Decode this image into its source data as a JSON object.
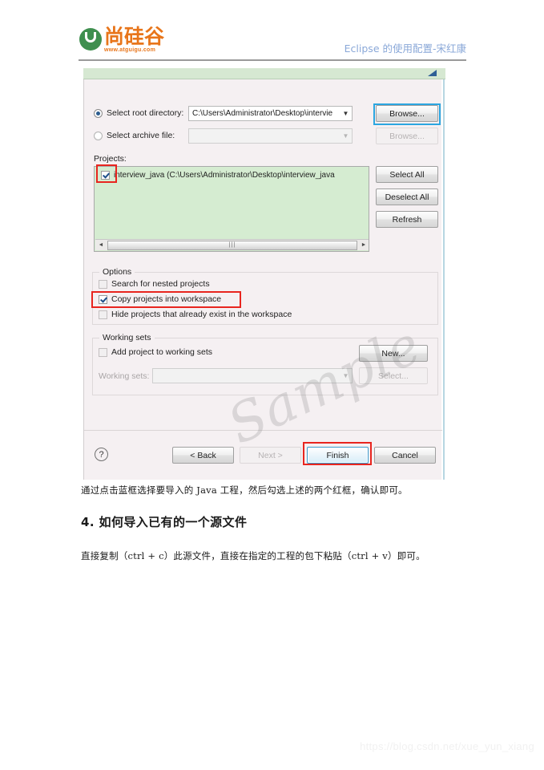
{
  "header": {
    "logo_cn": "尚硅谷",
    "logo_url": "www.atguigu.com",
    "title": "Eclipse 的使用配置-宋红康"
  },
  "dialog": {
    "radio_root": {
      "label": "Select root directory:",
      "selected": true
    },
    "radio_archive": {
      "label": "Select archive file:",
      "selected": false
    },
    "root_directory_value": "C:\\Users\\Administrator\\Desktop\\intervie",
    "archive_file_value": "",
    "browse_root_label": "Browse...",
    "browse_archive_label": "Browse...",
    "projects_label": "Projects:",
    "project_item": "interview_java (C:\\Users\\Administrator\\Desktop\\interview_java",
    "project_checked": true,
    "select_all_label": "Select All",
    "deselect_all_label": "Deselect All",
    "refresh_label": "Refresh",
    "scroll_left_glyph": "◄",
    "scroll_right_glyph": "►",
    "scroll_thumb_glyph": "|||",
    "options_group_title": "Options",
    "options": [
      {
        "label": "Search for nested projects",
        "checked": false
      },
      {
        "label": "Copy projects into workspace",
        "checked": true
      },
      {
        "label": "Hide projects that already exist in the workspace",
        "checked": false
      }
    ],
    "working_sets_group_title": "Working sets",
    "add_to_working_sets": {
      "label": "Add project to working sets",
      "checked": false
    },
    "working_sets_label": "Working sets:",
    "working_sets_value": "",
    "new_label": "New...",
    "select_label": "Select...",
    "help_glyph": "?",
    "back_label": "< Back",
    "next_label": "Next >",
    "finish_label": "Finish",
    "cancel_label": "Cancel",
    "combo_arrow_glyph": "▼",
    "sample_watermark": "Sample"
  },
  "document": {
    "caption": "通过点击蓝框选择要导入的 Java 工程，然后勾选上述的两个红框，确认即可。",
    "heading": "4.  如何导入已有的一个源文件",
    "paragraph": "直接复制（ctrl + c）此源文件，直接在指定的工程的包下粘贴（ctrl + v）即可。",
    "csdn_watermark": "https://blog.csdn.net/xue_yun_xiang"
  },
  "colors": {
    "header_title": "#8aa8d8",
    "logo_orange": "#e8751a",
    "logo_green": "#3f8f4f",
    "list_background": "#d5ecd1",
    "annotation_red": "#e8251f",
    "annotation_blue": "#2ba6e0"
  }
}
